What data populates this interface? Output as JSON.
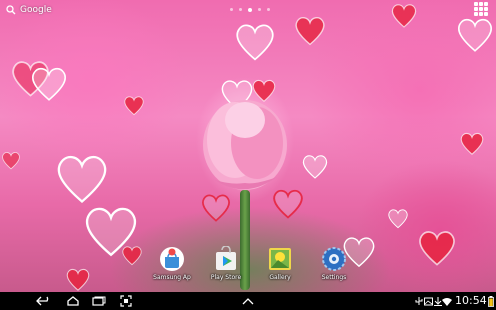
{
  "search": {
    "label": "Google"
  },
  "pages": {
    "count": 5,
    "active_index": 2
  },
  "dock_apps": [
    {
      "label": "Samsung Ap",
      "icon": "samsung-apps-icon"
    },
    {
      "label": "Play Store",
      "icon": "play-store-icon"
    },
    {
      "label": "Gallery",
      "icon": "gallery-icon"
    },
    {
      "label": "Settings",
      "icon": "settings-icon"
    }
  ],
  "navbar": {
    "buttons": [
      "back-icon",
      "home-icon",
      "recent-apps-icon",
      "screenshot-icon",
      "up-arrow-icon"
    ],
    "status_icons": [
      "usb-icon",
      "image-notification-icon",
      "download-icon",
      "wifi-icon",
      "battery-icon"
    ],
    "time": "10:54"
  },
  "colors": {
    "accent_pink": "#f06cb0",
    "heart_red": "#e8233f",
    "navbar_bg": "#000000"
  }
}
